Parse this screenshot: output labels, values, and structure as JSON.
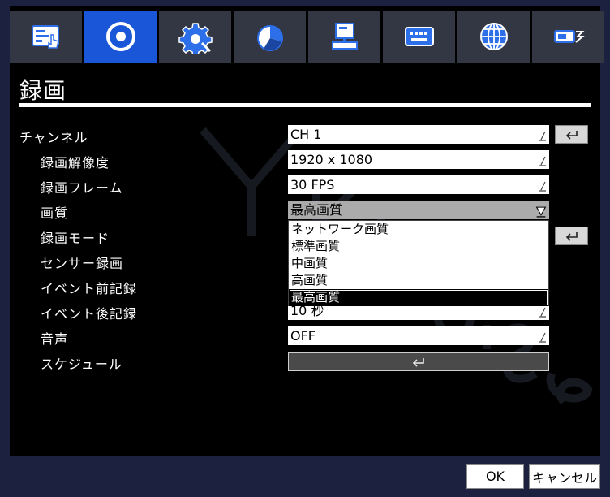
{
  "page": {
    "title": "録画"
  },
  "tabs": [
    {
      "icon": "display-touch-icon",
      "active": false
    },
    {
      "icon": "record-icon",
      "active": true
    },
    {
      "icon": "gear-icon",
      "active": false
    },
    {
      "icon": "pie-chart-icon",
      "active": false
    },
    {
      "icon": "computer-icon",
      "active": false
    },
    {
      "icon": "keyboard-icon",
      "active": false
    },
    {
      "icon": "globe-icon",
      "active": false
    },
    {
      "icon": "storage-icon",
      "active": false
    }
  ],
  "settings": [
    {
      "label": "チャンネル",
      "value": "CH 1"
    },
    {
      "label": "録画解像度",
      "value": "1920 x 1080"
    },
    {
      "label": "録画フレーム",
      "value": "30 FPS"
    },
    {
      "label": "画質",
      "value": "最高画質"
    },
    {
      "label": "録画モード",
      "value": ""
    },
    {
      "label": "センサー録画",
      "value": ""
    },
    {
      "label": "イベント前記録",
      "value": ""
    },
    {
      "label": "イベント後記録",
      "value": "10 秒"
    },
    {
      "label": "音声",
      "value": "OFF"
    },
    {
      "label": "スケジュール",
      "value": ""
    }
  ],
  "dropdown": {
    "options": [
      "ネットワーク画質",
      "標準画質",
      "中画質",
      "高画質",
      "最高画質"
    ],
    "selected_index": 4
  },
  "footer": {
    "ok": "OK",
    "cancel": "キャンセル"
  },
  "colors": {
    "active_tab": "#1a57d8",
    "tab": "#333743",
    "frame": "#1c2140"
  }
}
